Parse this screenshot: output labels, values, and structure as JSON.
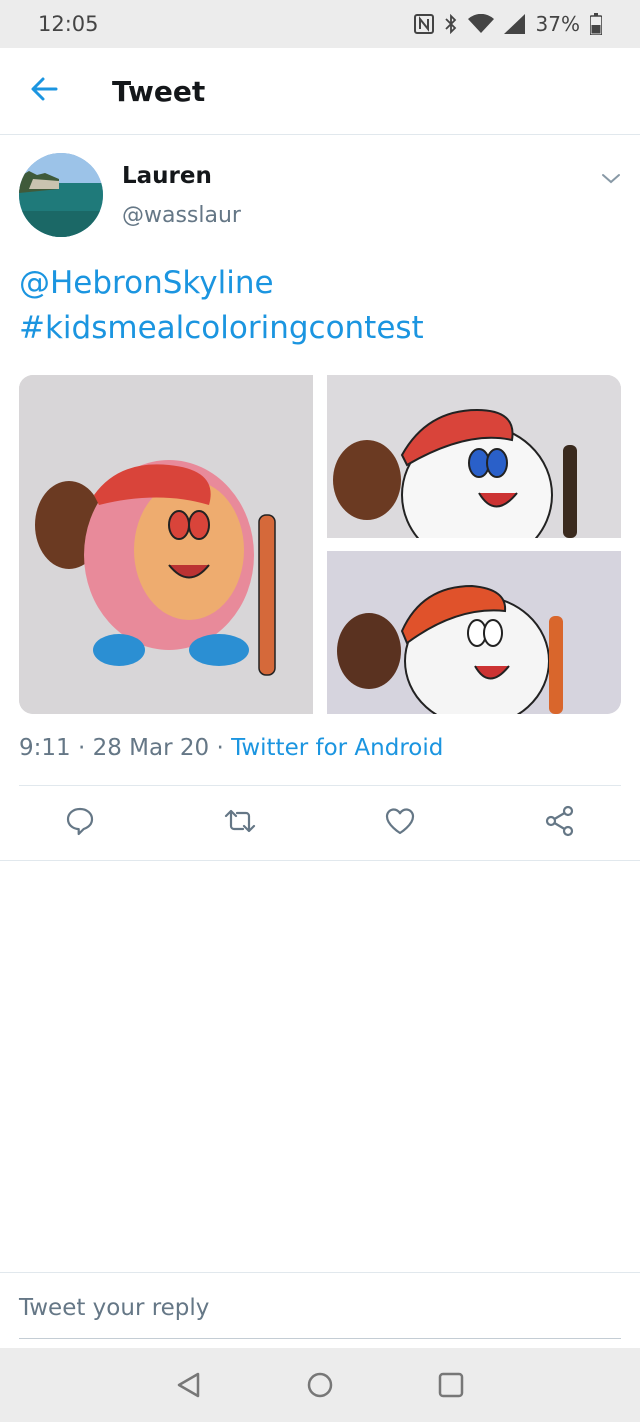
{
  "status_bar": {
    "time": "12:05",
    "battery": "37%"
  },
  "header": {
    "title": "Tweet"
  },
  "tweet": {
    "author_name": "Lauren",
    "author_handle": "@wasslaur",
    "text_line1": "@HebronSkyline",
    "text_line2": "#kidsmealcoloringcontest",
    "time": "9:11",
    "date": "28 Mar 20",
    "separator": " · ",
    "source": "Twitter for Android",
    "media": [
      {
        "icon": "baseball-drawing-colored"
      },
      {
        "icon": "baseball-drawing-blue-eyes"
      },
      {
        "icon": "baseball-drawing-plain"
      }
    ]
  },
  "actions": [
    "reply-icon",
    "retweet-icon",
    "like-icon",
    "share-icon"
  ],
  "reply": {
    "placeholder": "Tweet your reply"
  },
  "colors": {
    "accent": "#1b95e0",
    "secondary_text": "#657786",
    "status_bar_bg": "#ececec"
  }
}
